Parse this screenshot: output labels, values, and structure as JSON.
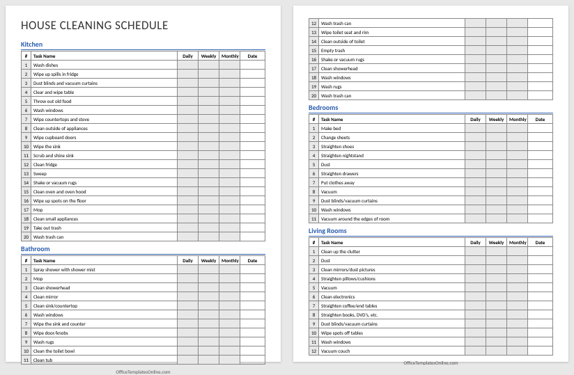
{
  "title": "HOUSE CLEANING SCHEDULE",
  "footer": "OfficeTemplatesOnline.com",
  "columns": {
    "num": "#",
    "task": "Task Name",
    "daily": "Daily",
    "weekly": "Weekly",
    "monthly": "Monthly",
    "date": "Date"
  },
  "sections": {
    "kitchen": {
      "title": "Kitchen",
      "tasks": [
        "Wash dishes",
        "Wipe up spills in fridge",
        "Dust blinds and vacuum curtains",
        "Clear and wipe table",
        "Throw out old food",
        "Wash windows",
        "Wipe countertops and stove",
        "Clean outside of appliances",
        "Wipe cupboard doors",
        "Wipe the sink",
        "Scrub and shine sink",
        "Clean fridge",
        "Sweep",
        "Shake or vacuum rugs",
        "Clean oven and oven hood",
        "Wipe up spots on the floor",
        "Mop",
        "Clean small appliances",
        "Take out trash",
        "Wash trash can"
      ]
    },
    "bathroom": {
      "title": "Bathroom",
      "tasks": [
        "Spray shower with shower mist",
        "Mop",
        "Clean showerhead",
        "Clean mirror",
        "Clean sink/countertop",
        "Wash windows",
        "Wipe the sink and counter",
        "Wipe door/knobs",
        "Wash rugs",
        "Clean the toilet bowl",
        "Clean tub"
      ]
    },
    "bathroom2": {
      "start": 12,
      "tasks": [
        "Wash trash can",
        "Wipe toilet seat and rim",
        "Clean outside of toilet",
        "Empty trash",
        "Shake or vacuum rugs",
        "Clean showerhead",
        "Wash windows",
        "Wash rugs",
        "Wash trash can"
      ]
    },
    "bedrooms": {
      "title": "Bedrooms",
      "tasks": [
        "Make bed",
        "Change sheets",
        "Straighten shoes",
        "Straighten nightstand",
        "Dust",
        "Straighten drawers",
        "Put clothes away",
        "Vacuum",
        "Dust blinds/vacuum curtains",
        "Wash windows",
        "Vacuum around the edges of room"
      ]
    },
    "living": {
      "title": "Living Rooms",
      "tasks": [
        "Clean up the clutter",
        "Dust",
        "Clean mirrors/dust pictures",
        "Straighten pillows/cushions",
        "Vacuum",
        "Clean electronics",
        "Straighten coffee/end tables",
        "Straighten books, DVD's, etc.",
        "Dust blinds/vacuum curtains",
        "Wipe spots off tables",
        "Wash windows",
        "Vacuum couch"
      ]
    }
  }
}
